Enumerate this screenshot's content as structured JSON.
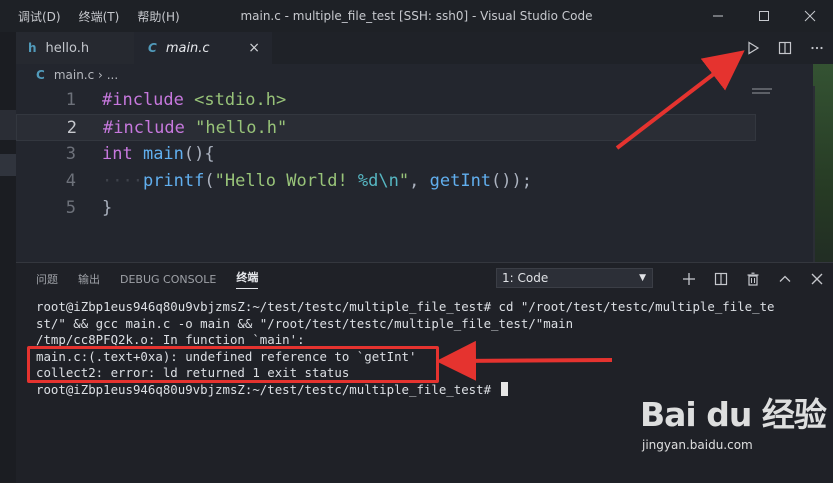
{
  "window": {
    "title": "main.c - multiple_file_test [SSH: ssh0] - Visual Studio Code",
    "menu": [
      "调试(D)",
      "终端(T)",
      "帮助(H)"
    ],
    "controls": [
      "minimize-icon",
      "maximize-icon",
      "close-icon"
    ]
  },
  "tabs": [
    {
      "label": "hello.h",
      "icon": "h",
      "icon_color": "#519aba",
      "active": false
    },
    {
      "label": "main.c",
      "icon": "C",
      "icon_color": "#519aba",
      "active": true,
      "close": "×"
    }
  ],
  "tab_actions": [
    "run-icon",
    "split-editor-icon",
    "more-icon"
  ],
  "breadcrumb": {
    "icon": "C",
    "file": "main.c",
    "separator": "›",
    "rest": "..."
  },
  "editor": {
    "line_numbers": [
      "1",
      "2",
      "3",
      "4",
      "5"
    ],
    "current_line": 2,
    "minimap_label": "minimap",
    "lines": [
      [
        {
          "t": "#include ",
          "c": "pp"
        },
        {
          "t": "<stdio.h>",
          "c": "str"
        }
      ],
      [
        {
          "t": "#include ",
          "c": "pp"
        },
        {
          "t": "\"hello.h\"",
          "c": "str"
        }
      ],
      [
        {
          "t": "int ",
          "c": "kw"
        },
        {
          "t": "main",
          "c": "fn"
        },
        {
          "t": "(){",
          "c": "pl"
        }
      ],
      [
        {
          "t": "····",
          "c": "ws"
        },
        {
          "t": "printf",
          "c": "fn"
        },
        {
          "t": "(",
          "c": "pl"
        },
        {
          "t": "\"Hello World! ",
          "c": "str"
        },
        {
          "t": "%d",
          "c": "esc"
        },
        {
          "t": "\\n",
          "c": "esc"
        },
        {
          "t": "\"",
          "c": "str"
        },
        {
          "t": ", ",
          "c": "pl"
        },
        {
          "t": "getInt",
          "c": "fn"
        },
        {
          "t": "());",
          "c": "pl"
        }
      ],
      [
        {
          "t": "}",
          "c": "pl"
        }
      ]
    ]
  },
  "panel": {
    "tabs": [
      "问题",
      "输出",
      "DEBUG CONSOLE",
      "终端"
    ],
    "active_tab": "终端",
    "terminal_select": "1: Code",
    "actions": [
      "add-terminal-icon",
      "split-terminal-icon",
      "trash-icon",
      "maximize-panel-icon",
      "close-panel-icon"
    ],
    "terminal_lines": [
      "root@iZbp1eus946q80u9vbjzmsZ:~/test/testc/multiple_file_test# cd \"/root/test/testc/multiple_file_te",
      "st/\" && gcc main.c -o main && \"/root/test/testc/multiple_file_test/\"main",
      "/tmp/cc8PFQ2k.o: In function `main':",
      "main.c:(.text+0xa): undefined reference to `getInt'",
      "collect2: error: ld returned 1 exit status",
      "root@iZbp1eus946q80u9vbjzmsZ:~/test/testc/multiple_file_test# "
    ]
  },
  "watermark": {
    "logo": "Bai du 经验",
    "url": "jingyan.baidu.com"
  },
  "colors": {
    "accent_red": "#e5332f",
    "keyword": "#c678dd",
    "string": "#98c379",
    "function": "#61afef"
  }
}
